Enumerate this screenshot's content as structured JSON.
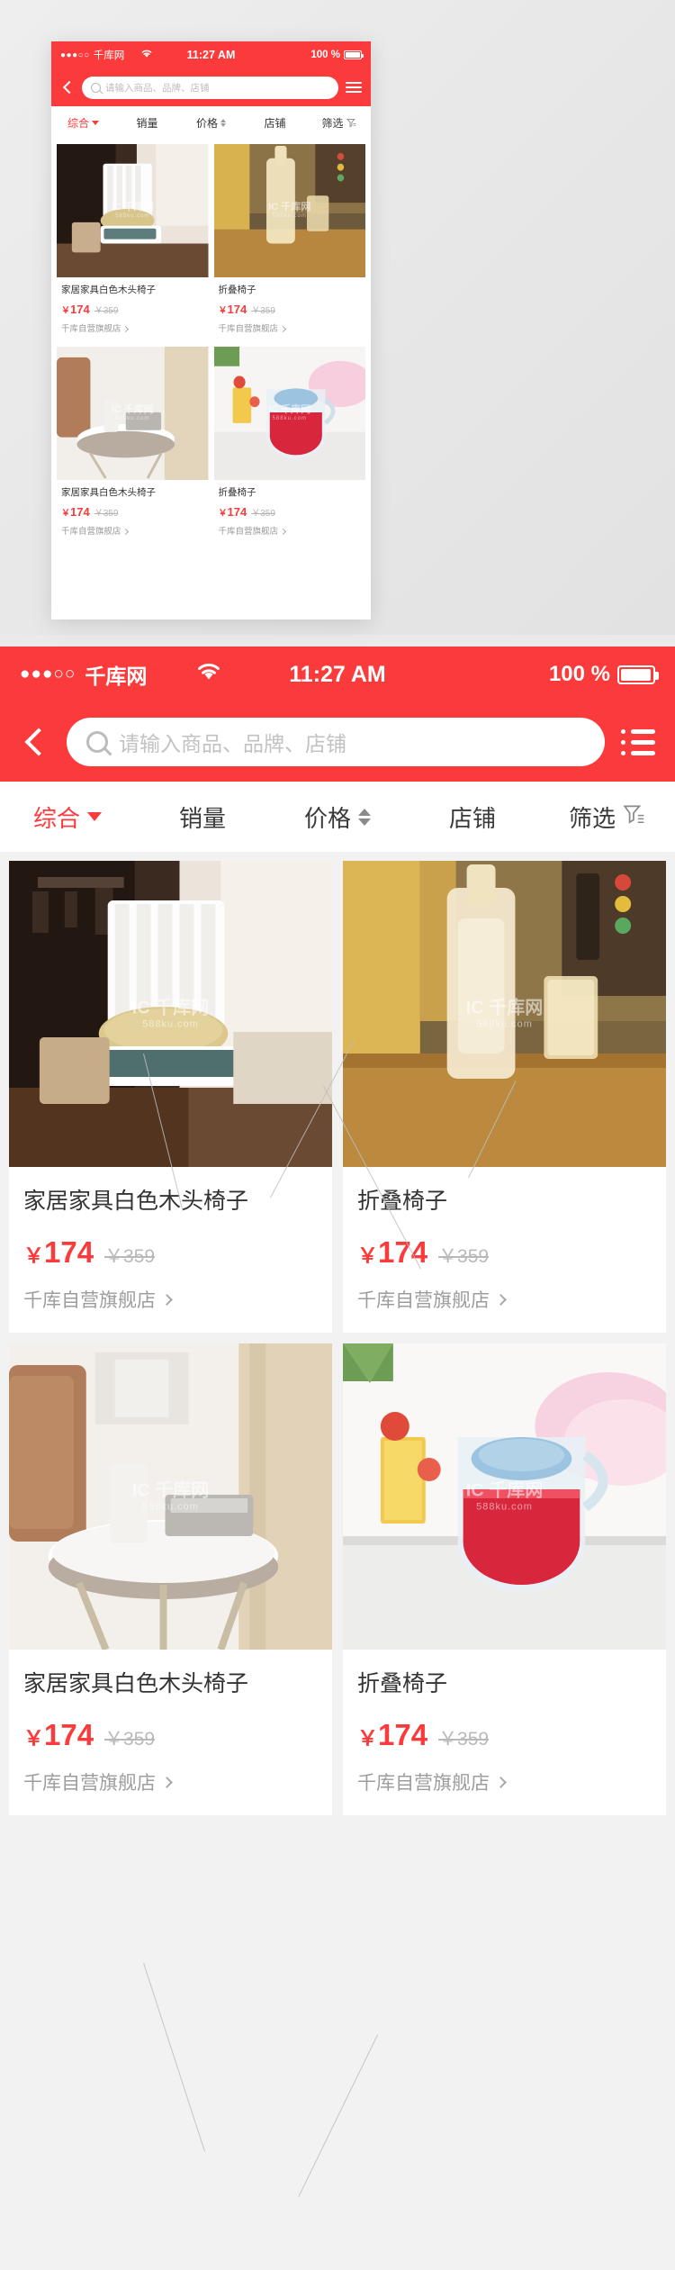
{
  "status_bar": {
    "signal_dots": "●●●○○",
    "carrier": "千库网",
    "wifi_icon": "wifi-icon",
    "time": "11:27 AM",
    "battery_percent": "100 %"
  },
  "search": {
    "back_icon": "back-chevron-icon",
    "search_icon": "search-icon",
    "placeholder": "请输入商品、品牌、店铺",
    "menu_icon": "list-menu-icon"
  },
  "filter_tabs": [
    {
      "label": "综合",
      "icon": "chevron-down-icon",
      "active": true
    },
    {
      "label": "销量",
      "icon": "",
      "active": false
    },
    {
      "label": "价格",
      "icon": "sort-updown-icon",
      "active": false
    },
    {
      "label": "店铺",
      "icon": "",
      "active": false
    },
    {
      "label": "筛选",
      "icon": "funnel-icon",
      "active": false
    }
  ],
  "products": [
    {
      "title": "家居家具白色木头椅子",
      "price_symbol": "￥",
      "price": "174",
      "original_price": "￥359",
      "shop": "千库自营旗舰店",
      "shop_chevron": "chevron-right-icon",
      "image_alt": "white-wooden-chair-photo"
    },
    {
      "title": "折叠椅子",
      "price_symbol": "￥",
      "price": "174",
      "original_price": "￥359",
      "shop": "千库自营旗舰店",
      "shop_chevron": "chevron-right-icon",
      "image_alt": "glass-bottle-on-table-photo"
    },
    {
      "title": "家居家具白色木头椅子",
      "price_symbol": "￥",
      "price": "174",
      "original_price": "￥359",
      "shop": "千库自营旗舰店",
      "shop_chevron": "chevron-right-icon",
      "image_alt": "round-side-table-speaker-photo"
    },
    {
      "title": "折叠椅子",
      "price_symbol": "￥",
      "price": "174",
      "original_price": "￥359",
      "shop": "千库自营旗舰店",
      "shop_chevron": "chevron-right-icon",
      "image_alt": "red-drink-glass-cup-photo"
    }
  ],
  "watermark": {
    "brand": "IC 千库网",
    "site": "588ku.com"
  },
  "colors": {
    "brand_red": "#fb3b3b",
    "price_red": "#fb3b3b",
    "muted_gray": "#9d9d9d",
    "page_bg": "#ececec"
  }
}
